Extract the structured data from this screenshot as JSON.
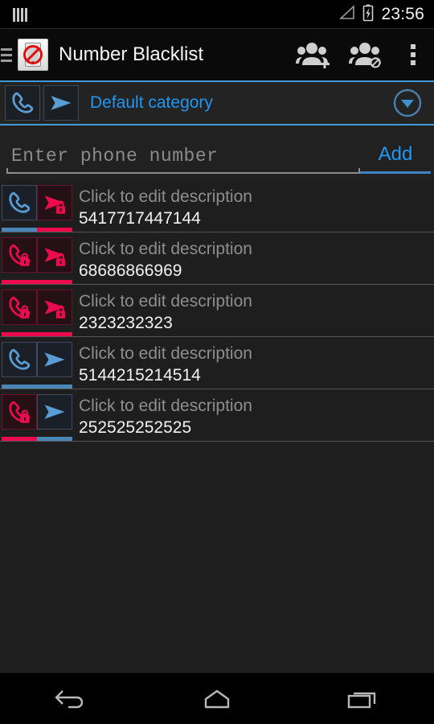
{
  "status_bar": {
    "left_icon": "signal-bars-icon",
    "signal_icon": "signal-triangle-icon",
    "battery_icon": "battery-charging-icon",
    "clock": "23:56"
  },
  "action_bar": {
    "drawer_icon": "drawer-indicator-icon",
    "app_icon": "blocked-phone-icon",
    "title": "Number Blacklist",
    "actions": [
      {
        "name": "add-group-button",
        "icon": "group-add-icon"
      },
      {
        "name": "block-group-button",
        "icon": "group-block-icon"
      },
      {
        "name": "overflow-menu-button",
        "icon": "overflow-dots-icon"
      }
    ]
  },
  "category_bar": {
    "call_icon": "phone-icon",
    "sms_icon": "sms-send-icon",
    "label": "Default category",
    "dropdown_icon": "chevron-down-circle-icon",
    "accent": "#2196f3",
    "border_color": "#3e9ad6"
  },
  "add_row": {
    "placeholder": "Enter phone number",
    "value": "",
    "add_label": "Add",
    "add_color": "#2196f3"
  },
  "colors": {
    "blue": "#4a86b8",
    "pink": "#ed0b4e",
    "background": "#1e1e1e",
    "text": "#f2f2f2",
    "muted": "#8e8e8e"
  },
  "list": {
    "description_placeholder": "Click to edit description",
    "rows": [
      {
        "description": "Click to edit description",
        "number": "5417717447144",
        "call": {
          "state": "blue",
          "locked": false
        },
        "sms": {
          "state": "pink",
          "locked": true
        }
      },
      {
        "description": "Click to edit description",
        "number": "68686866969",
        "call": {
          "state": "pink",
          "locked": true
        },
        "sms": {
          "state": "pink",
          "locked": true
        }
      },
      {
        "description": "Click to edit description",
        "number": "2323232323",
        "call": {
          "state": "pink",
          "locked": true
        },
        "sms": {
          "state": "pink",
          "locked": true
        }
      },
      {
        "description": "Click to edit description",
        "number": "5144215214514",
        "call": {
          "state": "blue",
          "locked": false
        },
        "sms": {
          "state": "blue",
          "locked": false
        }
      },
      {
        "description": "Click to edit description",
        "number": "252525252525",
        "call": {
          "state": "pink",
          "locked": true
        },
        "sms": {
          "state": "blue",
          "locked": false
        }
      }
    ]
  },
  "nav_bar": {
    "back": "back-icon",
    "home": "home-icon",
    "recents": "recents-icon"
  }
}
